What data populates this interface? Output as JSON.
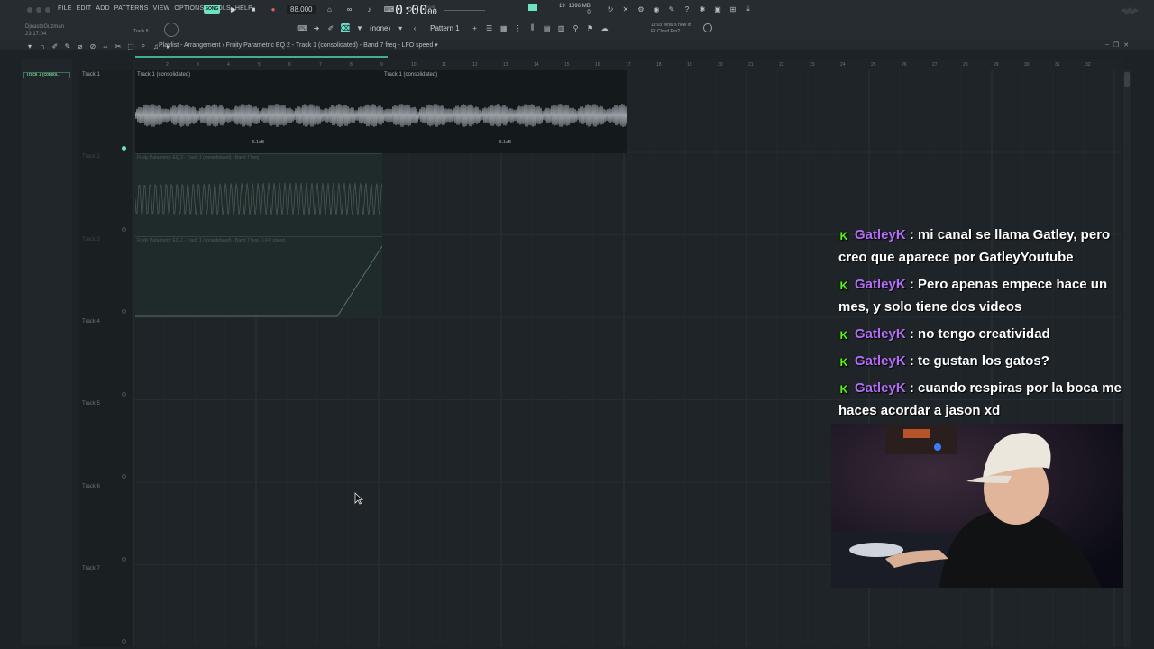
{
  "menu": [
    "FILE",
    "EDIT",
    "ADD",
    "PATTERNS",
    "VIEW",
    "OPTIONS",
    "TOOLS",
    "HELP"
  ],
  "user": {
    "name": "DjnastoGuzman",
    "clock": "23:17:04"
  },
  "transport": {
    "song_label": "SONG",
    "tempo": "88.000",
    "time": "0:00",
    "time_small": "00",
    "time_extra": "0:0:00"
  },
  "toolbar": {
    "snap": "(none)",
    "pattern": "Pattern 1",
    "track_label": "Track 8"
  },
  "cpu": {
    "value": "19",
    "ram": "1396 MB",
    "voices": "0"
  },
  "news": {
    "time": "11:03",
    "line1": "What's new in",
    "line2": "FL Cloud Pro?"
  },
  "breadcrumb": "Playlist - Arrangement › Fruity Parametric EQ 2 - Track 1 (consolidated) - Band 7 freq - LFO speed ▾",
  "left_panel_item": "Track 1 (consol...",
  "ruler": [
    "2",
    "3",
    "4",
    "5",
    "6",
    "7",
    "8",
    "9",
    "10",
    "11",
    "12",
    "13",
    "14",
    "15",
    "16",
    "17",
    "18",
    "19",
    "20",
    "21",
    "22",
    "23",
    "24",
    "25",
    "26",
    "27",
    "28",
    "29",
    "30",
    "31",
    "32"
  ],
  "tracks": [
    "Track 1",
    "Track 2",
    "Track 3",
    "Track 4",
    "Track 5",
    "Track 6",
    "Track 7"
  ],
  "clips": {
    "audio_a": "Track 1 (consolidated)",
    "audio_b": "Track 1 (consolidated)",
    "db_a": "5.1dB",
    "db_b": "5.1dB",
    "auto1": "Fruity Parametric EQ 2 - Track 1 (consolidated) - Band 7 freq",
    "auto2": "Fruity Parametric EQ 2 - Track 1 (consolidated) - Band 7 freq - LFO speed"
  },
  "chat": [
    {
      "user": "GatleyK",
      "text": ": mi canal se llama Gatley, pero creo que aparece por GatleyYoutube"
    },
    {
      "user": "GatleyK",
      "text": ": Pero apenas empece hace un mes, y solo tiene dos videos"
    },
    {
      "user": "GatleyK",
      "text": ": no tengo creatividad"
    },
    {
      "user": "GatleyK",
      "text": ": te gustan los gatos?"
    },
    {
      "user": "GatleyK",
      "text": ": cuando respiras por la boca me haces acordar a jason xd"
    }
  ],
  "badge_letter": "K",
  "colors": {
    "accent": "#6ee0c4",
    "username": "#b46df7",
    "badge": "#53fc18"
  }
}
